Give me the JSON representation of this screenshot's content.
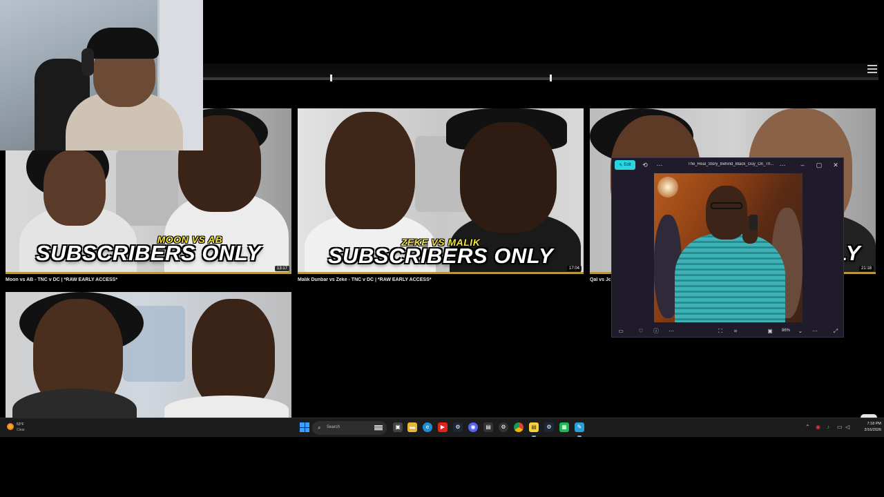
{
  "player": {
    "menu_icon": "hamburger-menu-icon"
  },
  "cards": [
    {
      "top_line": "MOON VS AB",
      "main_line": "SUBSCRIBERS ONLY",
      "duration": "13:17",
      "title": "Moon vs AB - TNC v DC | *RAW EARLY ACCESS*"
    },
    {
      "top_line": "ZEKE VS MALIK",
      "main_line": "SUBSCRIBERS ONLY",
      "duration": "17:04",
      "title": "Malik Dunbar vs Zeke - TNC v DC | *RAW EARLY ACCESS*"
    },
    {
      "main_line": "LY",
      "duration": "21:18",
      "title": "Qal vs Jon"
    },
    {}
  ],
  "viewer": {
    "edit_label": "Edit",
    "title": "The_Real_Story_Behind_Black_Guy_On_Th...",
    "zoom": "86%",
    "icons": [
      "edit-pencil-icon",
      "rotate-icon",
      "more-icon",
      "window-more-icon",
      "minimize-icon",
      "maximize-icon",
      "close-icon",
      "filmstrip-icon",
      "favorite-icon",
      "info-icon",
      "more-options-icon",
      "fit-icon",
      "fullscreen-select-icon",
      "screenshot-icon",
      "zoom-dropdown-icon",
      "expand-icon"
    ]
  },
  "taskbar": {
    "weather_temp": "53°F",
    "weather_cond": "Clear",
    "search_placeholder": "Search",
    "time": "7:18 PM",
    "date": "2/16/2026",
    "apps": [
      "task-view-icon",
      "file-explorer-icon",
      "edge-icon",
      "youtube-icon",
      "steam-icon",
      "discord-icon",
      "app-icon",
      "settings-icon",
      "chrome-icon",
      "sticky-notes-icon",
      "steam2-icon",
      "spotify-icon",
      "paint-icon"
    ]
  },
  "colors": {
    "accent": "#2ad4e0",
    "gold": "#b89a3c",
    "banner_yellow": "#f5e43a",
    "taskbar": "#1c1c1c"
  }
}
